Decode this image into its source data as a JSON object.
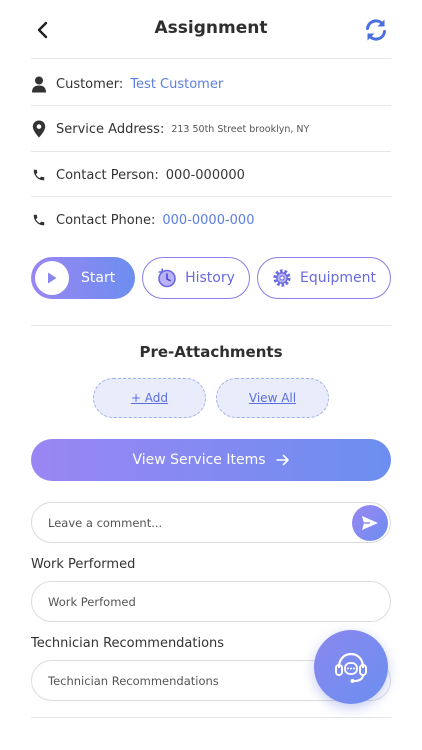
{
  "header": {
    "title": "Assignment",
    "back_icon": "chevron-left-icon",
    "refresh_icon": "refresh-icon"
  },
  "details": {
    "customer": {
      "label": "Customer:",
      "value": "Test Customer",
      "icon": "user-icon"
    },
    "service_address": {
      "label": "Service Address:",
      "value": "213 50th Street brooklyn, NY",
      "icon": "location-pin-icon"
    },
    "contact_person": {
      "label": "Contact Person:",
      "value": "000-000000",
      "icon": "phone-icon"
    },
    "contact_phone": {
      "label": "Contact Phone:",
      "value": "000-0000-000",
      "icon": "phone-icon"
    }
  },
  "actions": {
    "start_label": "Start",
    "history_label": "History",
    "equipment_label": "Equipment"
  },
  "attachments": {
    "title": "Pre-Attachments",
    "add_label": "+ Add",
    "view_all_label": "View All"
  },
  "service_items": {
    "label": "View Service Items"
  },
  "comment": {
    "placeholder": "Leave a comment..."
  },
  "work_performed": {
    "label": "Work Performed",
    "placeholder": "Work Perfomed"
  },
  "recommendations": {
    "label": "Technician Recommendations",
    "placeholder": "Technician Recommendations"
  },
  "colors": {
    "accent_start": "#9a86f2",
    "accent_end": "#6c8ef0",
    "link": "#5b7fe0",
    "refresh": "#4a6fe0"
  }
}
